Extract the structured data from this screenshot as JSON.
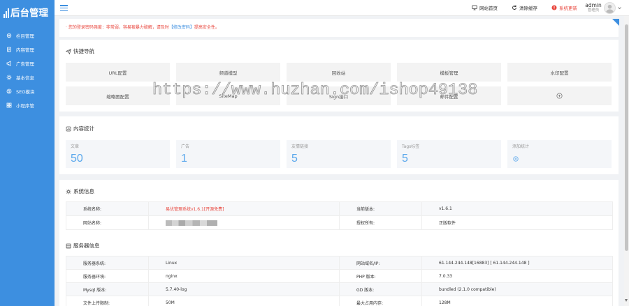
{
  "sidebar": {
    "logo": "后台管理",
    "items": [
      {
        "label": "栏目管理",
        "icon": "settings-icon"
      },
      {
        "label": "内容管理",
        "icon": "document-icon"
      },
      {
        "label": "广告管理",
        "icon": "bullhorn-icon"
      },
      {
        "label": "基本信息",
        "icon": "gear-icon"
      },
      {
        "label": "SEO模块",
        "icon": "seo-icon"
      },
      {
        "label": "小程序管",
        "icon": "grid-icon"
      }
    ]
  },
  "header": {
    "links": [
      {
        "label": "网站首页",
        "icon": "monitor-icon"
      },
      {
        "label": "清除缓存",
        "icon": "refresh-icon"
      },
      {
        "label": "系统更新",
        "icon": "alert-circle-icon"
      }
    ],
    "user": {
      "name": "admin",
      "role": "管理员"
    }
  },
  "notice": {
    "text_before": "· 您的登录密码强度：非常弱，容易被暴力破解，请及时",
    "link": "【修改密码】",
    "text_after": "提高安全性。"
  },
  "quick_nav": {
    "title": "快捷导航",
    "items": [
      "URL配置",
      "频道模型",
      "回收站",
      "模板管理",
      "水印配置",
      "缩略图配置",
      "SiteMap",
      "Sign接口",
      "邮件配置"
    ],
    "add_icon": "plus-circle-icon"
  },
  "stats": {
    "title": "内容统计",
    "items": [
      {
        "label": "文章",
        "value": "50"
      },
      {
        "label": "广告",
        "value": "1"
      },
      {
        "label": "友情链接",
        "value": "5"
      },
      {
        "label": "Tags标签",
        "value": "5"
      },
      {
        "label": "添加统计",
        "icon": "plus-circle-icon"
      }
    ]
  },
  "system_info": {
    "title": "系统信息",
    "rows": [
      {
        "label1": "系统名称:",
        "value1": "易优管理系统v1.6.1[开源免费]",
        "label2": "当前版本:",
        "value2": "v1.6.1"
      },
      {
        "label1": "网站名称:",
        "label2": "授权所有:",
        "value2": "正版软件"
      }
    ]
  },
  "server_info": {
    "title": "服务器信息",
    "rows": [
      {
        "label1": "服务器系统:",
        "value1": "Linux",
        "label2": "网站域名/IP:",
        "value2": "61.144.244.148[16883] [ 61.144.244.148 ]"
      },
      {
        "label1": "服务器环境:",
        "value1": "nginx",
        "label2": "PHP 版本:",
        "value2": "7.0.33"
      },
      {
        "label1": "Mysql 版本:",
        "value1": "5.7.40-log",
        "label2": "GD 版本:",
        "value2": "bundled (2.1.0 compatible)"
      },
      {
        "label1": "文件上传限制:",
        "value1": "50M",
        "label2": "最大占用内存:",
        "value2": "128M"
      }
    ]
  },
  "watermark": "https://www.huzhan.com/ishop49138",
  "colors": {
    "sidebar": "#3d8fe0",
    "accent": "#3d8fe0",
    "danger": "#e8453c",
    "stat_value": "#5ba8ec"
  }
}
